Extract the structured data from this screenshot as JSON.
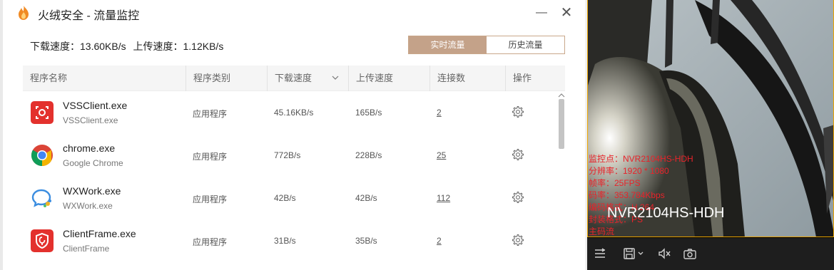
{
  "window": {
    "title": "火绒安全 - 流量监控",
    "speed_download": "下载速度：13.60KB/s",
    "speed_upload": "上传速度：1.12KB/s",
    "tabs": [
      "实时流量",
      "历史流量"
    ],
    "active_tab": "实时流量"
  },
  "table": {
    "headers": [
      "程序名称",
      "程序类别",
      "下载速度",
      "上传速度",
      "连接数",
      "操作"
    ],
    "rows": [
      {
        "name": "VSSClient.exe",
        "sub": "VSSClient.exe",
        "type": "应用程序",
        "down": "45.16KB/s",
        "up": "165B/s",
        "conn": "2",
        "icon": "vssclient-icon"
      },
      {
        "name": "chrome.exe",
        "sub": "Google Chrome",
        "type": "应用程序",
        "down": "772B/s",
        "up": "228B/s",
        "conn": "25",
        "icon": "chrome-icon"
      },
      {
        "name": "WXWork.exe",
        "sub": "WXWork.exe",
        "type": "应用程序",
        "down": "42B/s",
        "up": "42B/s",
        "conn": "112",
        "icon": "wxwork-icon"
      },
      {
        "name": "ClientFrame.exe",
        "sub": "ClientFrame",
        "type": "应用程序",
        "down": "31B/s",
        "up": "35B/s",
        "conn": "2",
        "icon": "clientframe-icon"
      }
    ]
  },
  "video": {
    "overlay": [
      "监控点：NVR2104HS-HDH",
      "分辨率：1920 * 1080",
      "帧率：25FPS",
      "码率：353.784Kbps",
      "编码格式：H.264",
      "封装格式：PS",
      "主码流"
    ],
    "camera_name": "NVR2104HS-HDH"
  },
  "colors": {
    "accent": "#c4a289",
    "overlay_text": "#e8232a",
    "frame_border": "#e9a300"
  }
}
